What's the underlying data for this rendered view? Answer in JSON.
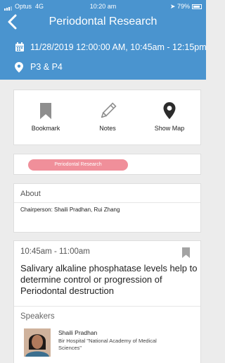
{
  "status_bar": {
    "carrier": "Optus",
    "network": "4G",
    "time": "10:20 am",
    "battery": "79%"
  },
  "header": {
    "title": "Periodontal Research",
    "datetime": "11/28/2019 12:00:00 AM, 10:45am - 12:15pm",
    "location": "P3 & P4",
    "background": "#4a94cf"
  },
  "actions": {
    "bookmark": "Bookmark",
    "notes": "Notes",
    "show_map": "Show Map"
  },
  "track_tag": {
    "label": "Periodontal Research",
    "color": "#f08f9a"
  },
  "about": {
    "heading": "About",
    "chairperson": "Chairperson:  Shaili  Pradhan, Rui  Zhang"
  },
  "session": {
    "time": "10:45am - 11:00am",
    "title": "Salivary alkaline phosphatase levels help to determine control or progression of Periodontal destruction",
    "speakers_heading": "Speakers",
    "speaker_name": "Shaili Pradhan",
    "speaker_org": "Bir Hospital \"National Academy of Medical Sciences\""
  }
}
